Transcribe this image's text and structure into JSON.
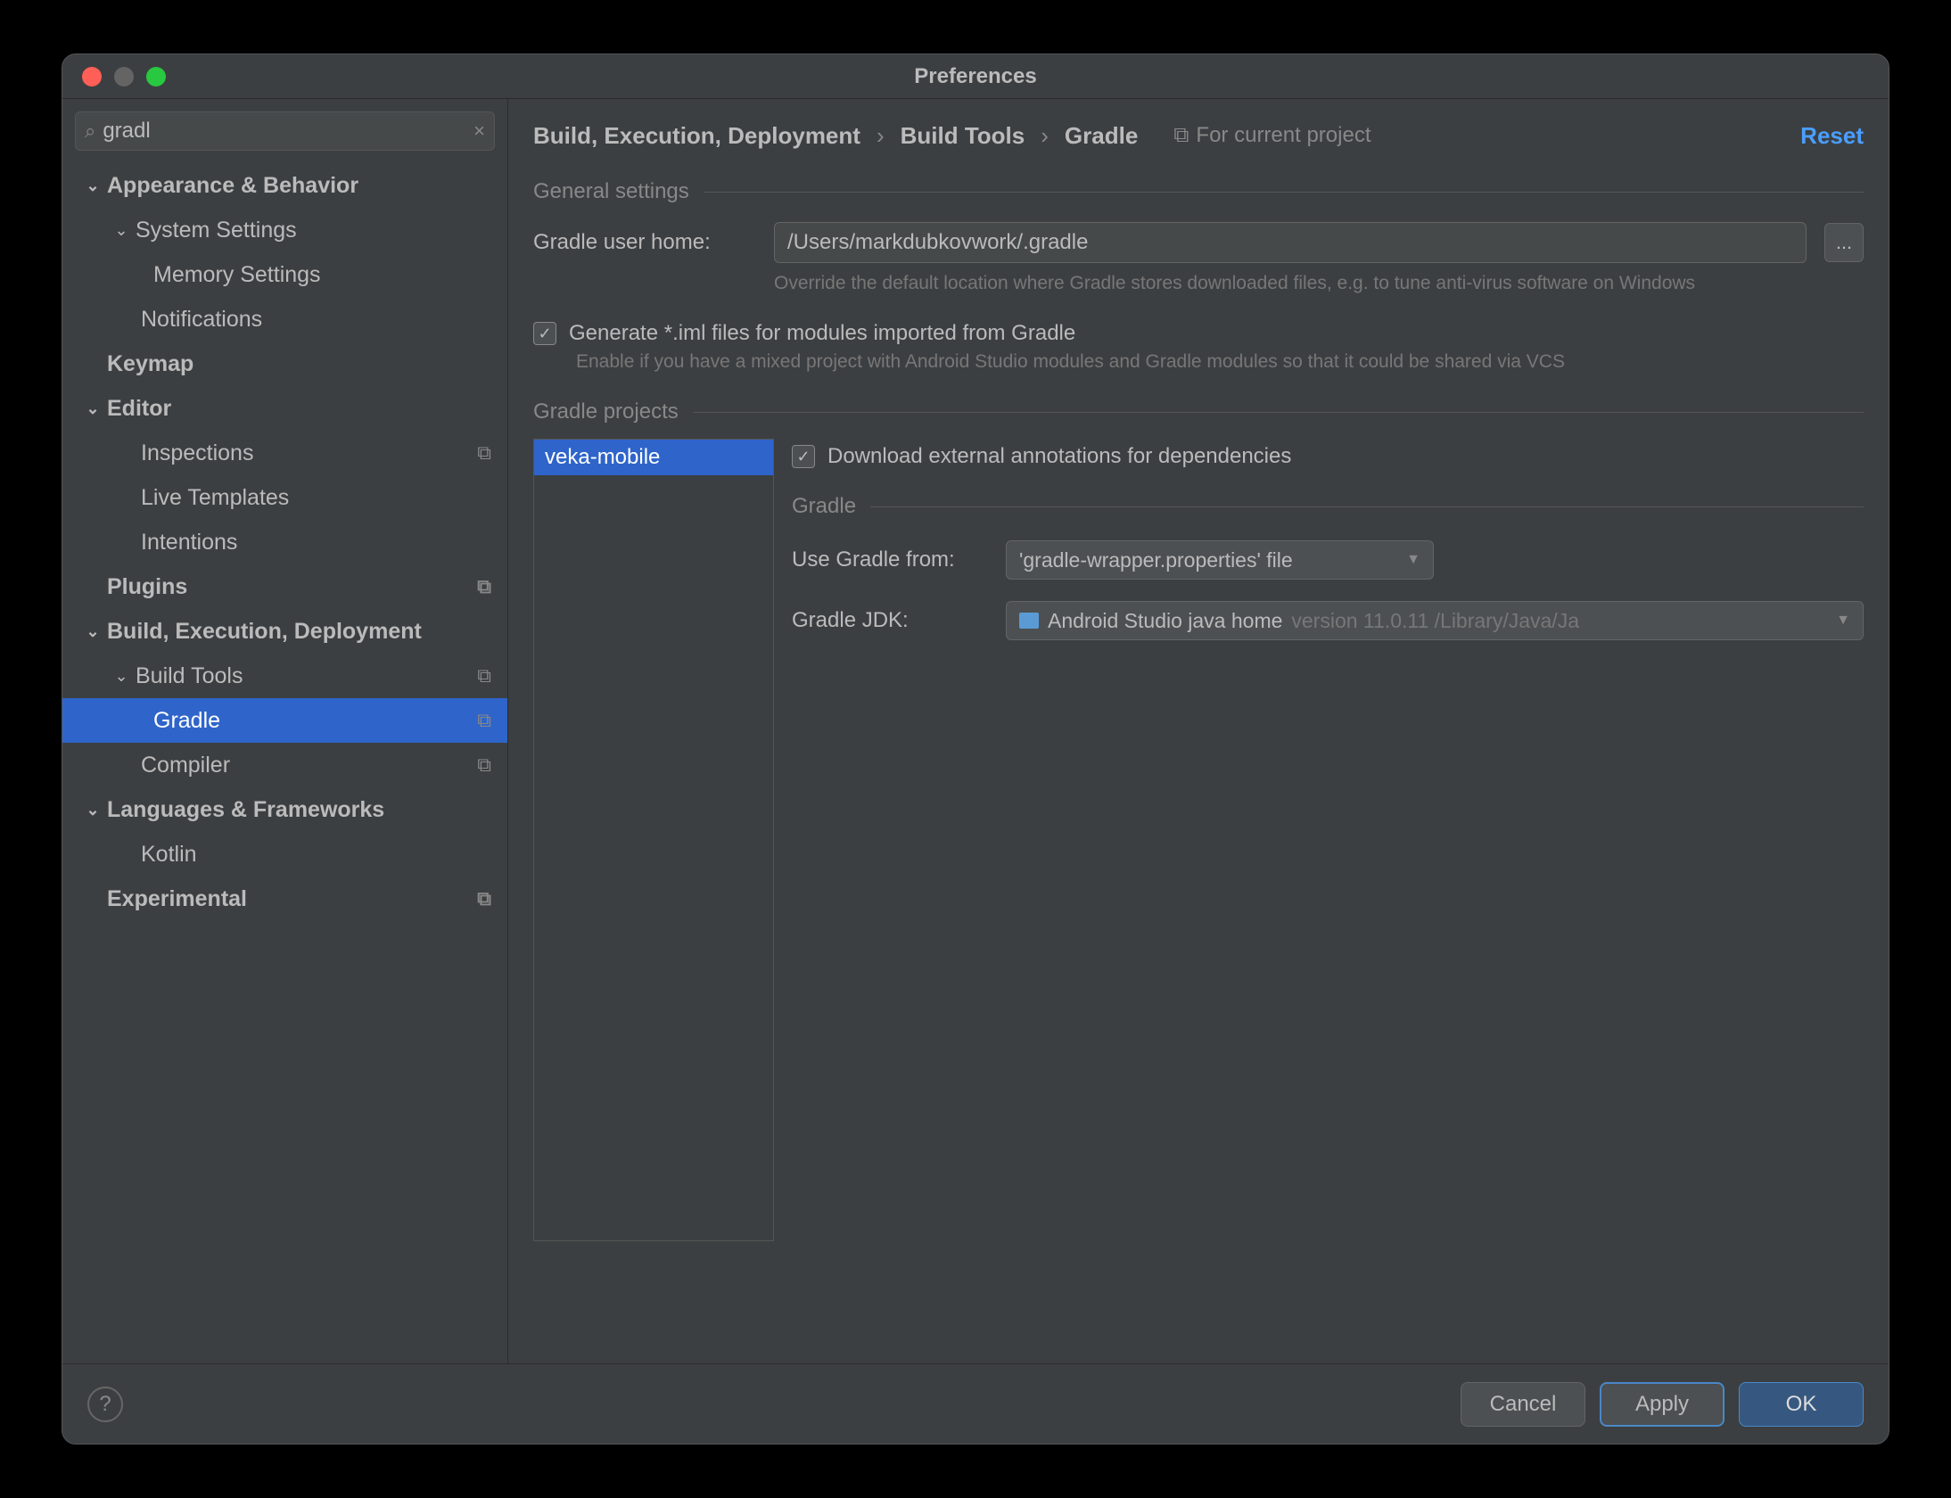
{
  "window": {
    "title": "Preferences"
  },
  "search": {
    "value": "gradl",
    "clear_char": "×",
    "search_char": "⌕"
  },
  "sidebar": {
    "items": [
      {
        "label": "Appearance & Behavior",
        "level": 0,
        "bold": true,
        "arrow": "⌄",
        "copy": false
      },
      {
        "label": "System Settings",
        "level": 1,
        "bold": false,
        "arrow": "⌄",
        "copy": false
      },
      {
        "label": "Memory Settings",
        "level": 2,
        "bold": false,
        "arrow": "",
        "copy": false
      },
      {
        "label": "Notifications",
        "level": 1,
        "bold": false,
        "arrow": "",
        "copy": false,
        "noarrow": true
      },
      {
        "label": "Keymap",
        "level": 0,
        "bold": true,
        "arrow": "",
        "copy": false,
        "noarrow": true
      },
      {
        "label": "Editor",
        "level": 0,
        "bold": true,
        "arrow": "⌄",
        "copy": false
      },
      {
        "label": "Inspections",
        "level": 1,
        "bold": false,
        "arrow": "",
        "copy": true,
        "noarrow": true
      },
      {
        "label": "Live Templates",
        "level": 1,
        "bold": false,
        "arrow": "",
        "copy": false,
        "noarrow": true
      },
      {
        "label": "Intentions",
        "level": 1,
        "bold": false,
        "arrow": "",
        "copy": false,
        "noarrow": true
      },
      {
        "label": "Plugins",
        "level": 0,
        "bold": true,
        "arrow": "",
        "copy": true,
        "noarrow": true
      },
      {
        "label": "Build, Execution, Deployment",
        "level": 0,
        "bold": true,
        "arrow": "⌄",
        "copy": false
      },
      {
        "label": "Build Tools",
        "level": 1,
        "bold": false,
        "arrow": "⌄",
        "copy": true
      },
      {
        "label": "Gradle",
        "level": 2,
        "bold": false,
        "arrow": "",
        "copy": true,
        "selected": true
      },
      {
        "label": "Compiler",
        "level": 1,
        "bold": false,
        "arrow": "",
        "copy": true,
        "noarrow": true
      },
      {
        "label": "Languages & Frameworks",
        "level": 0,
        "bold": true,
        "arrow": "⌄",
        "copy": false
      },
      {
        "label": "Kotlin",
        "level": 1,
        "bold": false,
        "arrow": "",
        "copy": false,
        "noarrow": true
      },
      {
        "label": "Experimental",
        "level": 0,
        "bold": true,
        "arrow": "",
        "copy": true,
        "noarrow": true
      }
    ]
  },
  "header": {
    "crumbs": [
      "Build, Execution, Deployment",
      "Build Tools",
      "Gradle"
    ],
    "sep": "›",
    "scope_label": "For current project",
    "reset": "Reset"
  },
  "general": {
    "section": "General settings",
    "user_home_label": "Gradle user home:",
    "user_home_value": "/Users/markdubkovwork/.gradle",
    "browse": "...",
    "user_home_hint": "Override the default location where Gradle stores downloaded files, e.g. to tune anti-virus software on Windows",
    "iml_checked": true,
    "iml_label": "Generate *.iml files for modules imported from Gradle",
    "iml_hint": "Enable if you have a mixed project with Android Studio modules and Gradle modules so that it could be shared via VCS"
  },
  "projects": {
    "section": "Gradle projects",
    "list": [
      "veka-mobile"
    ],
    "download_checked": true,
    "download_label": "Download external annotations for dependencies",
    "gradle_section": "Gradle",
    "use_from_label": "Use Gradle from:",
    "use_from_value": "'gradle-wrapper.properties' file",
    "jdk_label": "Gradle JDK:",
    "jdk_value": "Android Studio java home",
    "jdk_detail": "version 11.0.11 /Library/Java/Ja"
  },
  "footer": {
    "cancel": "Cancel",
    "apply": "Apply",
    "ok": "OK",
    "help": "?"
  }
}
